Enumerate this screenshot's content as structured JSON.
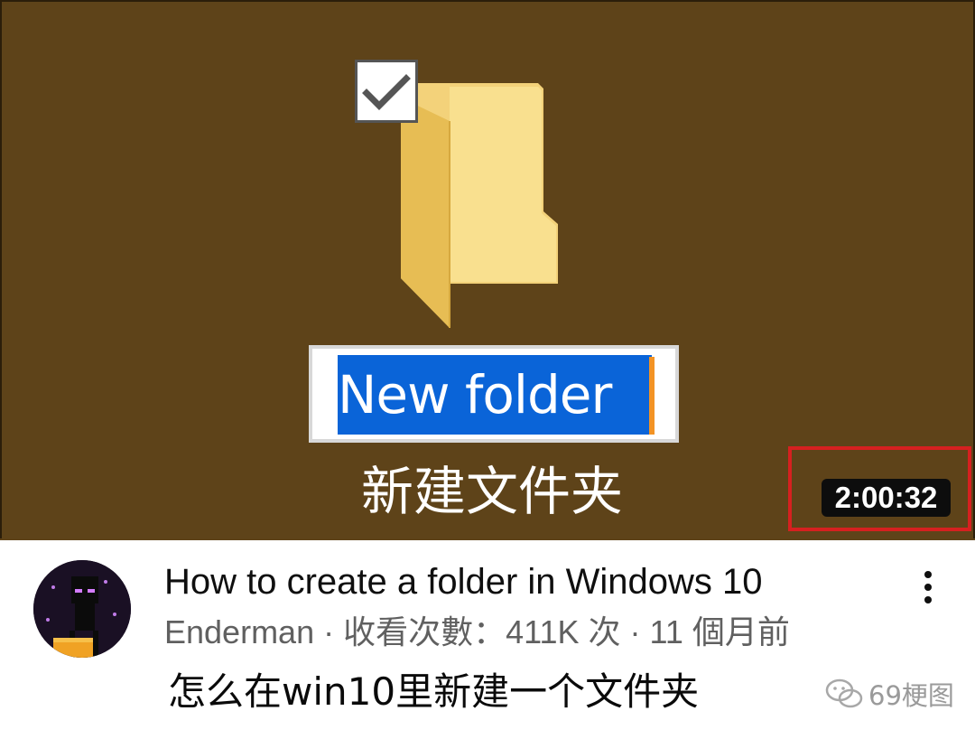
{
  "thumbnail": {
    "rename_text": "New folder",
    "subtitle": "新建文件夹",
    "duration": "2:00:32"
  },
  "video": {
    "title": "How to create a folder in Windows 10",
    "meta": "Enderman · 收看次數：411K 次 · 11 個月前"
  },
  "caption": "怎么在win10里新建一个文件夹",
  "watermark": "69梗图",
  "icons": {
    "folder": "folder-icon",
    "checkbox": "checkbox-checked-icon",
    "menu": "more-vert-icon",
    "avatar": "channel-avatar",
    "watermark": "wechat-icon"
  },
  "colors": {
    "desktop_bg": "#5e4319",
    "selection": "#0a64d8",
    "highlight_border": "#d62020",
    "duration_bg": "#0d0d0d",
    "meta_text": "#606060"
  }
}
